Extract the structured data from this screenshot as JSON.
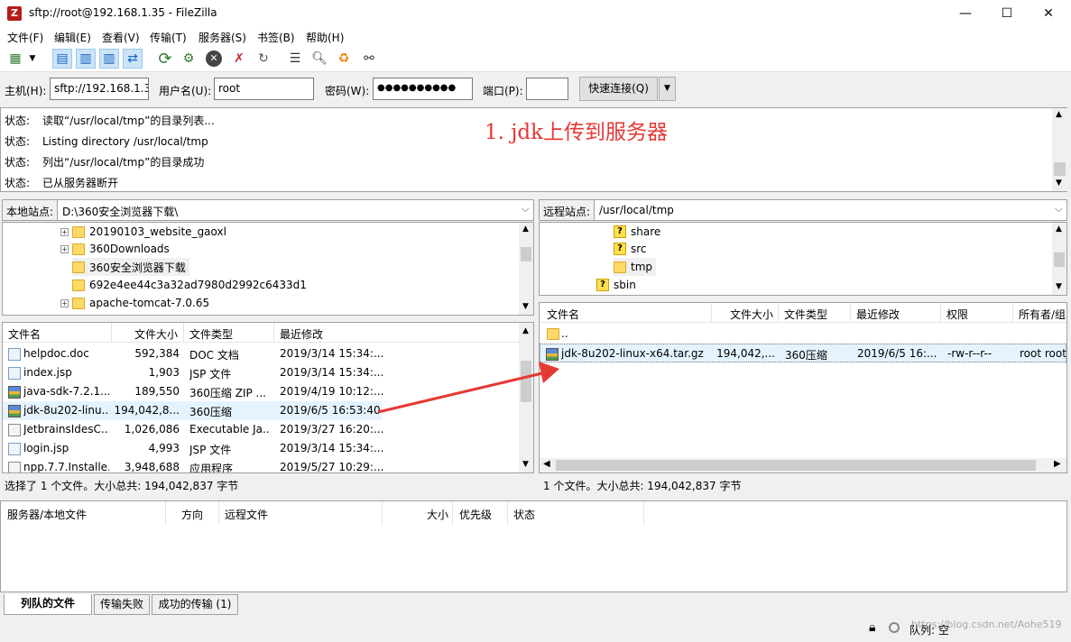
{
  "window": {
    "title": "sftp://root@192.168.1.35 - FileZilla",
    "app_icon": "Z"
  },
  "window_controls": {
    "minimize": "—",
    "maximize": "☐",
    "close": "✕"
  },
  "menu": [
    "文件(F)",
    "编辑(E)",
    "查看(V)",
    "传输(T)",
    "服务器(S)",
    "书签(B)",
    "帮助(H)"
  ],
  "quickconnect": {
    "host_label": "主机(H):",
    "host_value": "sftp://192.168.1.35",
    "user_label": "用户名(U):",
    "user_value": "root",
    "pass_label": "密码(W):",
    "pass_value": "●●●●●●●●●●",
    "port_label": "端口(P):",
    "port_value": "",
    "connect_label": "快速连接(Q)",
    "dropdown": "▼"
  },
  "log": [
    {
      "label": "状态:",
      "text": "读取“/usr/local/tmp”的目录列表..."
    },
    {
      "label": "状态:",
      "text": "Listing directory /usr/local/tmp"
    },
    {
      "label": "状态:",
      "text": "列出“/usr/local/tmp”的目录成功"
    },
    {
      "label": "状态:",
      "text": "已从服务器断开"
    }
  ],
  "annotation": "1.    jdk上传到服务器",
  "local": {
    "site_label": "本地站点:",
    "path": "D:\\360安全浏览器下载\\",
    "tree": [
      {
        "name": "20190103_website_gaoxl",
        "expander": "+"
      },
      {
        "name": "360Downloads",
        "expander": "+"
      },
      {
        "name": "360安全浏览器下载",
        "expander": ""
      },
      {
        "name": "692e4ee44c3a32ad7980d2992c6433d1",
        "expander": ""
      },
      {
        "name": "apache-tomcat-7.0.65",
        "expander": "+"
      }
    ],
    "columns": [
      "文件名",
      "文件大小",
      "文件类型",
      "最近修改"
    ],
    "files": [
      {
        "name": "helpdoc.doc",
        "size": "592,384",
        "type": "DOC 文档",
        "modified": "2019/3/14 15:34:..."
      },
      {
        "name": "index.jsp",
        "size": "1,903",
        "type": "JSP 文件",
        "modified": "2019/3/14 15:34:..."
      },
      {
        "name": "java-sdk-7.2.1...",
        "size": "189,550",
        "type": "360压缩 ZIP ...",
        "modified": "2019/4/19 10:12:..."
      },
      {
        "name": "jdk-8u202-linu...",
        "size": "194,042,8...",
        "type": "360压缩",
        "modified": "2019/6/5 16:53:40"
      },
      {
        "name": "JetbrainsIdesC...",
        "size": "1,026,086",
        "type": "Executable Ja...",
        "modified": "2019/3/27 16:20:..."
      },
      {
        "name": "login.jsp",
        "size": "4,993",
        "type": "JSP 文件",
        "modified": "2019/3/14 15:34:..."
      },
      {
        "name": "npp.7.7.Installe...",
        "size": "3,948,688",
        "type": "应用程序",
        "modified": "2019/5/27 10:29:..."
      }
    ],
    "status": "选择了 1 个文件。大小总共: 194,042,837 字节"
  },
  "remote": {
    "site_label": "远程站点:",
    "path": "/usr/local/tmp",
    "tree": [
      {
        "name": "share",
        "unknown": true
      },
      {
        "name": "src",
        "unknown": true
      },
      {
        "name": "tmp",
        "unknown": false
      },
      {
        "name": "sbin",
        "unknown": true
      }
    ],
    "columns": [
      "文件名",
      "文件大小",
      "文件类型",
      "最近修改",
      "权限",
      "所有者/组"
    ],
    "files": [
      {
        "name": "..",
        "size": "",
        "type": "",
        "modified": "",
        "perm": "",
        "owner": ""
      },
      {
        "name": "jdk-8u202-linux-x64.tar.gz",
        "size": "194,042,...",
        "type": "360压缩",
        "modified": "2019/6/5 16:...",
        "perm": "-rw-r--r--",
        "owner": "root root"
      }
    ],
    "status": "1 个文件。大小总共: 194,042,837 字节"
  },
  "queue": {
    "columns": [
      "服务器/本地文件",
      "方向",
      "远程文件",
      "大小",
      "优先级",
      "状态"
    ],
    "tabs": [
      "列队的文件",
      "传输失败",
      "成功的传输 (1)"
    ]
  },
  "bottom": {
    "queue_label": "队列: 空",
    "watermark": "https://blog.csdn.net/Aohe519"
  },
  "colors": {
    "accent": "#cce4f7",
    "annotation": "#e53935",
    "selection": "#e5f3ff",
    "folder": "#ffd965"
  }
}
